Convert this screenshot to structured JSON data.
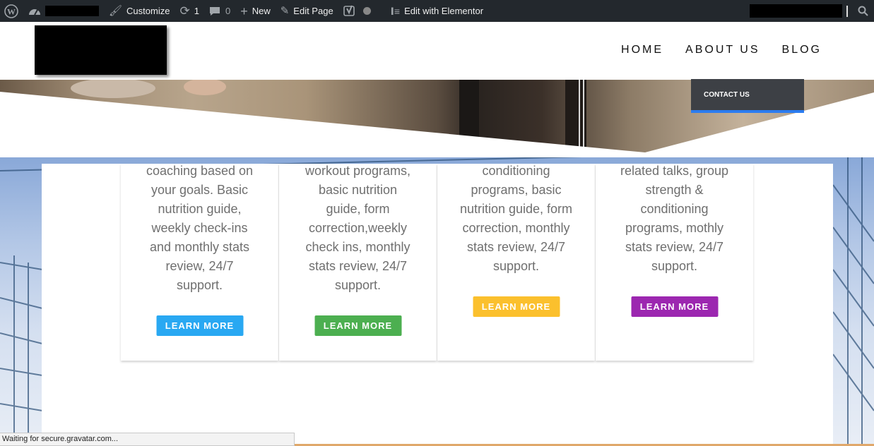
{
  "adminbar": {
    "customize": "Customize",
    "updates_count": "1",
    "comments_count": "0",
    "new_label": "New",
    "edit_page": "Edit Page",
    "edit_elementor": "Edit with Elementor"
  },
  "nav": {
    "items": [
      "HOME",
      "ABOUT US",
      "BLOG"
    ],
    "submenu": "CONTACT US"
  },
  "cards": [
    {
      "text": "coaching based on\nyour goals. Basic\nnutrition guide,\nweekly check-ins\nand monthly stats\nreview, 24/7\nsupport.",
      "button": "LEARN MORE",
      "color": "#29a8f2"
    },
    {
      "text": "workout programs,\nbasic nutrition\nguide, form\ncorrection,weekly\ncheck ins, monthly\nstats review, 24/7\nsupport.",
      "button": "LEARN MORE",
      "color": "#4caf50"
    },
    {
      "text": "conditioning\nprograms, basic\nnutrition guide, form\ncorrection, monthly\nstats review, 24/7\nsupport.",
      "button": "LEARN MORE",
      "color": "#fbc02d"
    },
    {
      "text": "related talks, group\nstrength &\nconditioning\nprograms, mothly\nstats review, 24/7\nsupport.",
      "button": "LEARN MORE",
      "color": "#9c27b0"
    }
  ],
  "status_text": "Waiting for secure.gravatar.com..."
}
